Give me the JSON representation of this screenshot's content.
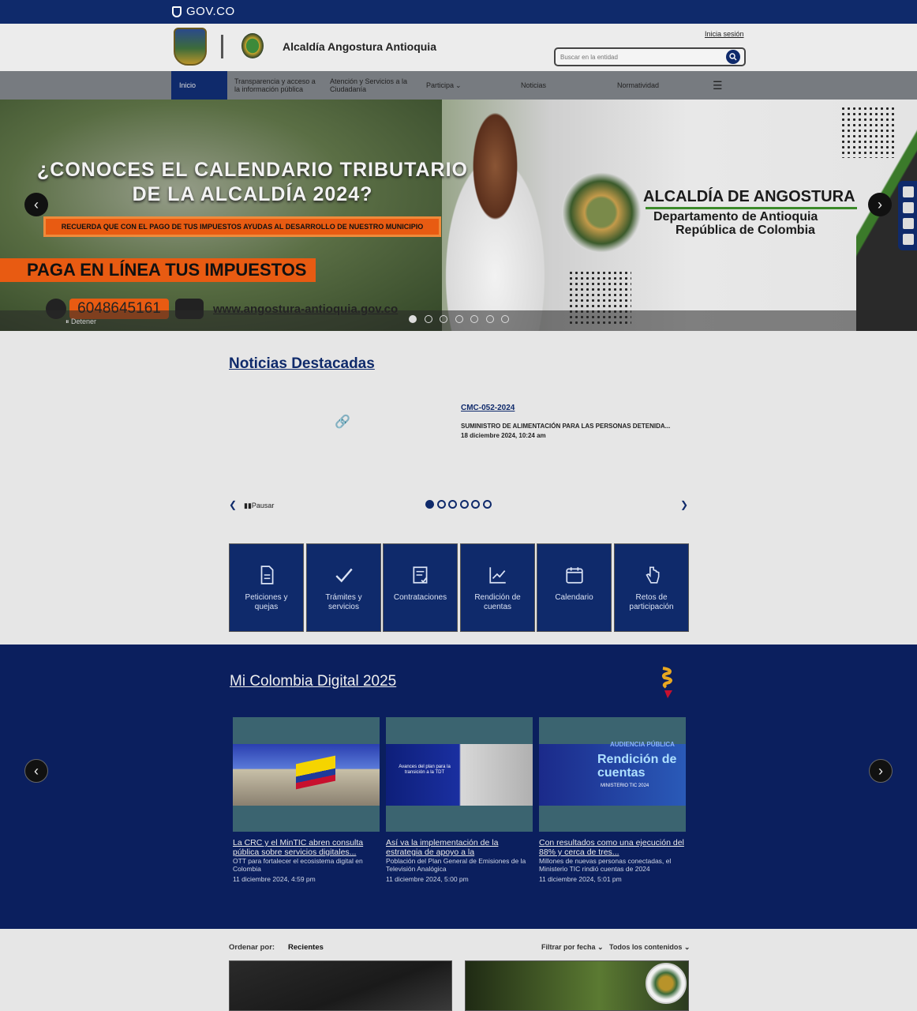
{
  "gov_bar": {
    "label": "GOV.CO"
  },
  "header": {
    "site_title": "Alcaldía Angostura Antioquia",
    "login": "Inicia sesión",
    "search_placeholder": "Buscar en la entidad"
  },
  "nav": {
    "items": [
      {
        "label": "Inicio"
      },
      {
        "label": "Transparencia y acceso a la información pública"
      },
      {
        "label": "Atención y Servicios a la Ciudadanía"
      },
      {
        "label": "Participa"
      },
      {
        "label": "Noticias"
      },
      {
        "label": "Normatividad"
      }
    ]
  },
  "hero": {
    "title_line1": "¿CONOCES EL CALENDARIO TRIBUTARIO",
    "title_line2": "DE LA ALCALDÍA 2024?",
    "reminder": "RECUERDA QUE CON EL PAGO DE TUS IMPUESTOS AYUDAS AL DESARROLLO DE NUESTRO MUNICIPIO",
    "pay_online": "PAGA EN LÍNEA TUS IMPUESTOS",
    "phone": "6048645161",
    "website": "www.angostura-antioquia.gov.co",
    "org_name": "ALCALDÍA DE ANGOSTURA",
    "org_dept": "Departamento de Antioquia",
    "org_country": "República de Colombia",
    "stop_label": "Detener",
    "slide_count": 7,
    "active_slide": 1
  },
  "noticias": {
    "title": "Noticias Destacadas",
    "item_code": "CMC-052-2024",
    "item_desc": "SUMINISTRO DE ALIMENTACIÓN PARA LAS PERSONAS DETENIDA...",
    "item_date": "18 diciembre 2024, 10:24 am",
    "pause_label": "Pausar",
    "dots": 6,
    "active_dot": 1
  },
  "tiles": [
    {
      "label": "Peticiones y quejas",
      "icon": "document-icon"
    },
    {
      "label": "Trámites y servicios",
      "icon": "checkmark-icon"
    },
    {
      "label": "Contrataciones",
      "icon": "contract-icon"
    },
    {
      "label": "Rendición de cuentas",
      "icon": "chart-icon"
    },
    {
      "label": "Calendario",
      "icon": "calendar-icon"
    },
    {
      "label": "Retos de participación",
      "icon": "hand-pointer-icon"
    }
  ],
  "mi_colombia": {
    "title": "Mi Colombia Digital 2025",
    "cards": [
      {
        "title": "La CRC y el MinTIC abren consulta pública sobre servicios digitales...",
        "desc": "OTT para fortalecer el ecosistema digital en Colombia",
        "date": "11 diciembre 2024, 4:59 pm"
      },
      {
        "title": "Así va la implementación de la estrategia de apoyo a la",
        "desc": "Población del Plan General de Emisiones de la Televisión Analógica",
        "date": "11 diciembre 2024, 5:00 pm",
        "image_text": "Avances del plan para la transición a la TDT"
      },
      {
        "title": "Con resultados como una ejecución del 88% y cerca de tres...",
        "desc": "Millones de nuevas personas conectadas, el Ministerio TIC rindió cuentas de 2024",
        "date": "11 diciembre 2024, 5:01 pm",
        "image_text_top": "AUDIENCIA PÚBLICA",
        "image_text_main": "Rendición de cuentas",
        "image_text_sub": "MINISTERIO TIC 2024"
      }
    ]
  },
  "listing": {
    "sort_label": "Ordenar por:",
    "sort_value": "Recientes",
    "filter_date": "Filtrar por fecha",
    "filter_all": "Todos los contenidos"
  },
  "colors": {
    "navy": "#0f2a6b",
    "orange": "#e85b12",
    "gray_nav": "#777b80"
  }
}
